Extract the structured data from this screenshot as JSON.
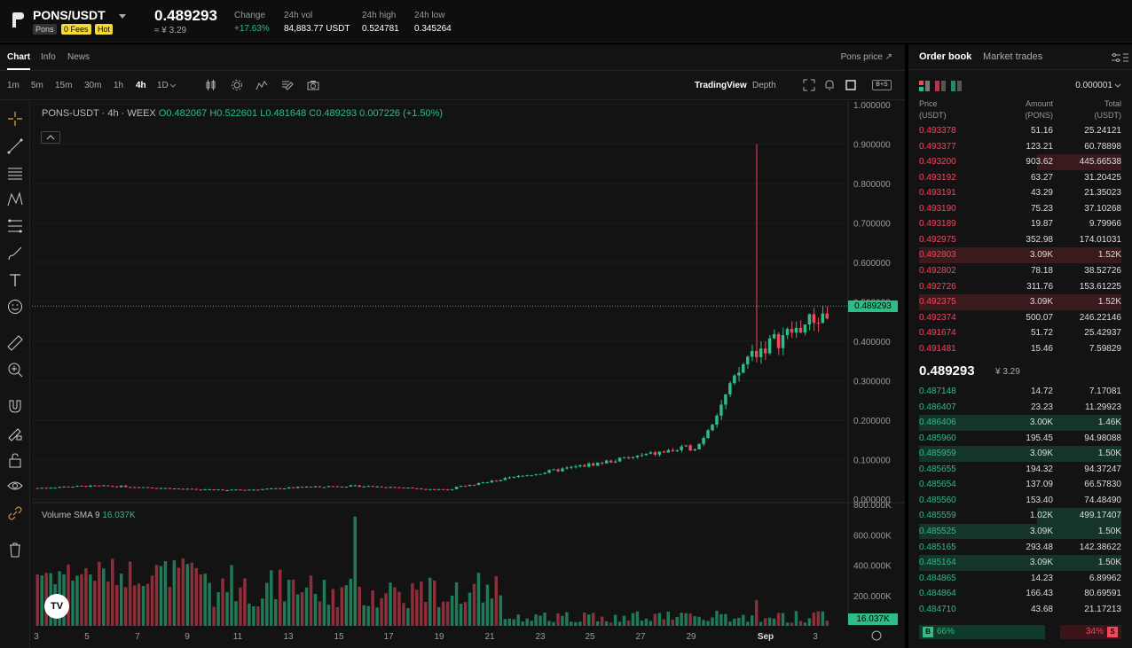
{
  "header": {
    "pair": "PONS/USDT",
    "tags": {
      "token": "Pons",
      "fees": "0 Fees",
      "hot": "Hot"
    },
    "price": "0.489293",
    "price_sub": "≈ ¥ 3.29",
    "stats": [
      {
        "label": "Change",
        "value": "+17.63%"
      },
      {
        "label": "24h vol",
        "value": "84,883.77 USDT"
      },
      {
        "label": "24h high",
        "value": "0.524781"
      },
      {
        "label": "24h low",
        "value": "0.345264"
      }
    ]
  },
  "chart_tabs": {
    "chart": "Chart",
    "info": "Info",
    "news": "News",
    "pons_price": "Pons price ↗"
  },
  "timeframes": [
    "1m",
    "5m",
    "15m",
    "30m",
    "1h",
    "4h",
    "1D"
  ],
  "active_timeframe": "4h",
  "views": {
    "tradingview": "TradingView",
    "depth": "Depth",
    "toggle": "B+S"
  },
  "legend": {
    "symbol": "PONS-USDT · 4h · WEEX",
    "o": "O0.482067",
    "h": "H0.522601",
    "l": "L0.481648",
    "c": "C0.489293",
    "chg": "0.007226 (+1.50%)"
  },
  "volume_legend": {
    "label": "Volume SMA 9",
    "value": "16.037K"
  },
  "last_price_tag": "0.489293",
  "volume_tag": "16.037K",
  "tv_logo": "TV",
  "chart_data": {
    "type": "candlestick",
    "price_axis": [
      "1.000000",
      "0.900000",
      "0.800000",
      "0.700000",
      "0.600000",
      "0.500000",
      "0.400000",
      "0.300000",
      "0.200000",
      "0.100000",
      "0.000000"
    ],
    "volume_axis": [
      "800.000K",
      "600.000K",
      "400.000K",
      "200.000K"
    ],
    "x_ticks": [
      "3",
      "5",
      "7",
      "9",
      "11",
      "13",
      "15",
      "17",
      "19",
      "21",
      "23",
      "25",
      "27",
      "29",
      "Sep",
      "3"
    ],
    "ylim": [
      0,
      1.0
    ],
    "volume_ylim": [
      0,
      800000
    ],
    "last_price": 0.489293
  },
  "orderbook": {
    "tabs": {
      "book": "Order book",
      "trades": "Market trades"
    },
    "precision": "0.000001",
    "headers": {
      "price": "Price",
      "price_unit": "(USDT)",
      "amount": "Amount",
      "amount_unit": "(PONS)",
      "total": "Total",
      "total_unit": "(USDT)"
    },
    "asks": [
      {
        "price": "0.493378",
        "amount": "51.16",
        "total": "25.24121"
      },
      {
        "price": "0.493377",
        "amount": "123.21",
        "total": "60.78898"
      },
      {
        "price": "0.493200",
        "amount": "903.62",
        "total": "445.66538"
      },
      {
        "price": "0.493192",
        "amount": "63.27",
        "total": "31.20425"
      },
      {
        "price": "0.493191",
        "amount": "43.29",
        "total": "21.35023"
      },
      {
        "price": "0.493190",
        "amount": "75.23",
        "total": "37.10268"
      },
      {
        "price": "0.493189",
        "amount": "19.87",
        "total": "9.79966"
      },
      {
        "price": "0.492975",
        "amount": "352.98",
        "total": "174.01031"
      },
      {
        "price": "0.492803",
        "amount": "3.09K",
        "total": "1.52K"
      },
      {
        "price": "0.492802",
        "amount": "78.18",
        "total": "38.52726"
      },
      {
        "price": "0.492726",
        "amount": "311.76",
        "total": "153.61225"
      },
      {
        "price": "0.492375",
        "amount": "3.09K",
        "total": "1.52K"
      },
      {
        "price": "0.492374",
        "amount": "500.07",
        "total": "246.22146"
      },
      {
        "price": "0.491674",
        "amount": "51.72",
        "total": "25.42937"
      },
      {
        "price": "0.491481",
        "amount": "15.46",
        "total": "7.59829"
      }
    ],
    "mid_price": "0.489293",
    "mid_sub": "¥ 3.29",
    "bids": [
      {
        "price": "0.487148",
        "amount": "14.72",
        "total": "7.17081"
      },
      {
        "price": "0.486407",
        "amount": "23.23",
        "total": "11.29923"
      },
      {
        "price": "0.486406",
        "amount": "3.00K",
        "total": "1.46K"
      },
      {
        "price": "0.485960",
        "amount": "195.45",
        "total": "94.98088"
      },
      {
        "price": "0.485959",
        "amount": "3.09K",
        "total": "1.50K"
      },
      {
        "price": "0.485655",
        "amount": "194.32",
        "total": "94.37247"
      },
      {
        "price": "0.485654",
        "amount": "137.09",
        "total": "66.57830"
      },
      {
        "price": "0.485560",
        "amount": "153.40",
        "total": "74.48490"
      },
      {
        "price": "0.485559",
        "amount": "1.02K",
        "total": "499.17407"
      },
      {
        "price": "0.485525",
        "amount": "3.09K",
        "total": "1.50K"
      },
      {
        "price": "0.485165",
        "amount": "293.48",
        "total": "142.38622"
      },
      {
        "price": "0.485164",
        "amount": "3.09K",
        "total": "1.50K"
      },
      {
        "price": "0.484865",
        "amount": "14.23",
        "total": "6.89962"
      },
      {
        "price": "0.484864",
        "amount": "166.43",
        "total": "80.69591"
      },
      {
        "price": "0.484710",
        "amount": "43.68",
        "total": "21.17213"
      }
    ],
    "buy_label": "B",
    "buy_pct": "66%",
    "sell_label": "S",
    "sell_pct": "34%",
    "buy_ratio": 0.66,
    "sell_ratio": 0.34
  },
  "colors": {
    "up": "#2ebd85",
    "down": "#f6465d",
    "bg": "#131313"
  }
}
